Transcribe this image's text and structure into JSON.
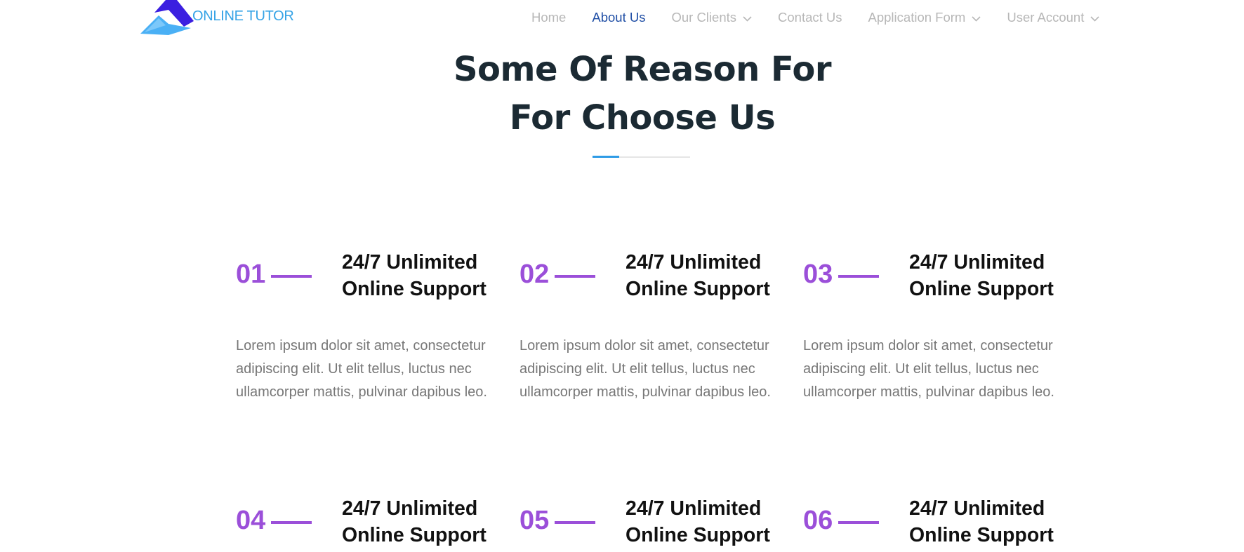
{
  "brand": {
    "name": "ONLINE TUTOR",
    "logo_icon": "triangle-logo-icon",
    "colors": {
      "logo_dark": "#3b1fe0",
      "logo_light": "#4ab0f5",
      "text": "#35a3e6"
    }
  },
  "nav": {
    "items": [
      {
        "label": "Home",
        "active": false,
        "has_dropdown": false
      },
      {
        "label": "About Us",
        "active": true,
        "has_dropdown": false
      },
      {
        "label": "Our Clients",
        "active": false,
        "has_dropdown": true
      },
      {
        "label": "Contact Us",
        "active": false,
        "has_dropdown": false
      },
      {
        "label": "Application Form",
        "active": false,
        "has_dropdown": true
      },
      {
        "label": "User Account",
        "active": false,
        "has_dropdown": true
      }
    ],
    "colors": {
      "inactive": "#b7b7b7",
      "active": "#1f4ea5"
    }
  },
  "section": {
    "title_line1": "Some Of Reason For",
    "title_line2": "For Choose Us",
    "accent_color": "#2e9be6"
  },
  "features": {
    "accent_color": "#9b4fd9",
    "items": [
      {
        "number": "01",
        "title_line1": "24/7 Unlimited",
        "title_line2": "Online Support",
        "text": "Lorem ipsum dolor sit amet, consectetur adipiscing elit. Ut elit tellus, luctus nec ullamcorper mattis, pulvinar dapibus leo."
      },
      {
        "number": "02",
        "title_line1": "24/7 Unlimited",
        "title_line2": "Online Support",
        "text": "Lorem ipsum dolor sit amet, consectetur adipiscing elit. Ut elit tellus, luctus nec ullamcorper mattis, pulvinar dapibus leo."
      },
      {
        "number": "03",
        "title_line1": "24/7 Unlimited",
        "title_line2": "Online Support",
        "text": "Lorem ipsum dolor sit amet, consectetur adipiscing elit. Ut elit tellus, luctus nec ullamcorper mattis, pulvinar dapibus leo."
      },
      {
        "number": "04",
        "title_line1": "24/7 Unlimited",
        "title_line2": "Online Support",
        "text": ""
      },
      {
        "number": "05",
        "title_line1": "24/7 Unlimited",
        "title_line2": "Online Support",
        "text": ""
      },
      {
        "number": "06",
        "title_line1": "24/7 Unlimited",
        "title_line2": "Online Support",
        "text": ""
      }
    ]
  }
}
